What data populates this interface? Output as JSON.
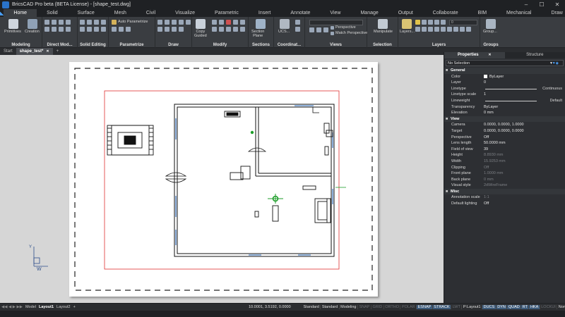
{
  "window": {
    "title": "BricsCAD Pro beta (BETA License) - [shape_test.dwg]",
    "minimize": "–",
    "maximize": "☐",
    "close": "✕"
  },
  "ribbon_tabs": [
    "Home",
    "Solid",
    "Surface",
    "Mesh",
    "Civil",
    "Visualize",
    "Parametric",
    "Insert",
    "Annotate",
    "View",
    "Manage",
    "Output",
    "Collaborate",
    "BIM",
    "Mechanical",
    "Draw"
  ],
  "ribbon": {
    "primitives": "Primitives",
    "creation": "Creation",
    "auto_parametrize": "Auto Parametrize",
    "copy_guided": "Copy\nGuided",
    "section_plane": "Section\nPlane",
    "ucs": "UCS...",
    "perspective": "Perspective",
    "match_perspective": "Match Perspective",
    "manipulate": "Manipulate",
    "layers": "Layers...",
    "layer_value": "0",
    "groups": "Group...",
    "panels": [
      "Modeling",
      "Direct Mod...",
      "Solid Editing",
      "Parametrize",
      "Draw",
      "Modify",
      "Sections",
      "Coordinat...",
      "Views",
      "Selection",
      "Layers",
      "Groups"
    ]
  },
  "doc_tabs": [
    "Start",
    "shape_test*"
  ],
  "doc_tab_add": "+",
  "properties": {
    "tabs": [
      "Properties",
      "Structure"
    ],
    "selection": "No Selection",
    "sections": [
      {
        "title": "General",
        "rows": [
          {
            "k": "Color",
            "v": "ByLayer"
          },
          {
            "k": "Layer",
            "v": "0"
          },
          {
            "k": "Linetype",
            "v": "",
            "extra": "Continuous"
          },
          {
            "k": "Linetype scale",
            "v": "1"
          },
          {
            "k": "Lineweight",
            "v": "",
            "extra": "Default"
          },
          {
            "k": "Transparency",
            "v": "ByLayer"
          },
          {
            "k": "Elevation",
            "v": "0 mm"
          }
        ]
      },
      {
        "title": "View",
        "rows": [
          {
            "k": "Camera",
            "v": "0.0000, 0.0000, 1.0000"
          },
          {
            "k": "Target",
            "v": "0.0000, 0.0000, 0.0000"
          },
          {
            "k": "Perspective",
            "v": "Off"
          },
          {
            "k": "Lens length",
            "v": "50.0000 mm"
          },
          {
            "k": "Field of view",
            "v": "39"
          },
          {
            "k": "Height",
            "v": "8.8930 mm",
            "dim": true
          },
          {
            "k": "Width",
            "v": "15.9253 mm",
            "dim": true
          },
          {
            "k": "Clipping",
            "v": "Off",
            "dim": true
          },
          {
            "k": "Front plane",
            "v": "1.0000 mm",
            "dim": true
          },
          {
            "k": "Back plane",
            "v": "0 mm",
            "dim": true
          },
          {
            "k": "Visual style",
            "v": "2dWireFrame",
            "dim": true
          }
        ]
      },
      {
        "title": "Misc",
        "rows": [
          {
            "k": "Annotation scale",
            "v": "1:1",
            "dim": true
          },
          {
            "k": "Default lighting",
            "v": "Off"
          }
        ]
      }
    ]
  },
  "status": {
    "layout_tabs": [
      "Model",
      "Layout1",
      "Layout2"
    ],
    "layout_add": "+",
    "coords": "10.0001, 3.5192, 0.0000",
    "flags": [
      {
        "t": "Standard",
        "s": "on"
      },
      {
        "t": "Standard",
        "s": ""
      },
      {
        "t": "Modeling",
        "s": ""
      },
      {
        "t": "SNAP",
        "s": "off"
      },
      {
        "t": "GRID",
        "s": "off"
      },
      {
        "t": "ORTHO",
        "s": "off"
      },
      {
        "t": "POLAR",
        "s": "off"
      },
      {
        "t": "ESNAP",
        "s": "on"
      },
      {
        "t": "STRACK",
        "s": "on"
      },
      {
        "t": "LWT",
        "s": "off"
      },
      {
        "t": "P:Layout1",
        "s": ""
      },
      {
        "t": "DUCS",
        "s": "on"
      },
      {
        "t": "DYN",
        "s": "on"
      },
      {
        "t": "QUAD",
        "s": "on"
      },
      {
        "t": "RT",
        "s": "on"
      },
      {
        "t": "HKA",
        "s": "on"
      },
      {
        "t": "LOCKUI",
        "s": "off"
      },
      {
        "t": "None",
        "s": ""
      }
    ]
  },
  "ucs_labels": {
    "y": "Y",
    "w": "W"
  },
  "colors": {
    "accent": "#4aa3ff",
    "viewport_border": "#e03030",
    "ribbon_bg": "#3a3d41"
  }
}
